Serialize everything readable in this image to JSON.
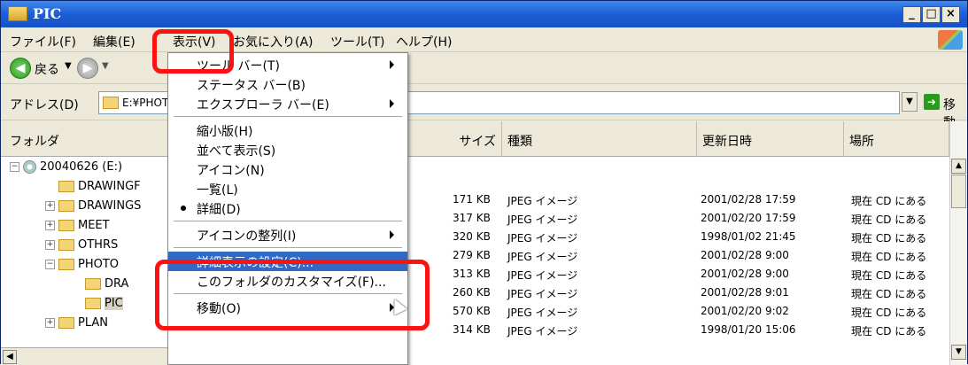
{
  "window": {
    "title": "PIC"
  },
  "menubar": {
    "items": [
      "ファイル(F)",
      "編集(E)",
      "表示(V)",
      "お気に入り(A)",
      "ツール(T)",
      "ヘルプ(H)"
    ]
  },
  "toolbar": {
    "back_label": "戻る"
  },
  "address": {
    "label": "アドレス(D)",
    "value": "E:¥PHOTO¥PIC",
    "go_label": "移動"
  },
  "folder_pane": {
    "header": "フォルダ",
    "tree": [
      {
        "label": "20040626 (E:)",
        "expander": "−",
        "icon": "cd-icon",
        "indent": 0
      },
      {
        "label": "DRAWINGF",
        "expander": "",
        "icon": "folder-icon",
        "indent": 1
      },
      {
        "label": "DRAWINGS",
        "expander": "+",
        "icon": "folder-icon",
        "indent": 1
      },
      {
        "label": "MEET",
        "expander": "+",
        "icon": "folder-icon",
        "indent": 1
      },
      {
        "label": "OTHRS",
        "expander": "+",
        "icon": "folder-icon",
        "indent": 1
      },
      {
        "label": "PHOTO",
        "expander": "−",
        "icon": "folder-icon",
        "indent": 1
      },
      {
        "label": "DRA",
        "expander": "",
        "icon": "folder-icon",
        "indent": 2
      },
      {
        "label": "PIC",
        "expander": "",
        "icon": "folder-icon",
        "indent": 2,
        "selected": true
      },
      {
        "label": "PLAN",
        "expander": "+",
        "icon": "folder-icon",
        "indent": 1
      }
    ]
  },
  "file_pane": {
    "columns": [
      "サイズ",
      "種類",
      "更新日時",
      "場所"
    ],
    "rows": [
      {
        "size": "171 KB",
        "type": "JPEG イメージ",
        "date": "2001/02/28 17:59",
        "location": "現在 CD にある"
      },
      {
        "size": "317 KB",
        "type": "JPEG イメージ",
        "date": "2001/02/20 17:59",
        "location": "現在 CD にある"
      },
      {
        "size": "320 KB",
        "type": "JPEG イメージ",
        "date": "1998/01/02 21:45",
        "location": "現在 CD にある"
      },
      {
        "size": "279 KB",
        "type": "JPEG イメージ",
        "date": "2001/02/28 9:00",
        "location": "現在 CD にある"
      },
      {
        "size": "313 KB",
        "type": "JPEG イメージ",
        "date": "2001/02/28 9:00",
        "location": "現在 CD にある"
      },
      {
        "size": "260 KB",
        "type": "JPEG イメージ",
        "date": "2001/02/28 9:01",
        "location": "現在 CD にある"
      },
      {
        "size": "570 KB",
        "type": "JPEG イメージ",
        "date": "2001/02/20 9:02",
        "location": "現在 CD にある"
      },
      {
        "size": "314 KB",
        "type": "JPEG イメージ",
        "date": "1998/01/20 15:06",
        "location": "現在 CD にある"
      }
    ]
  },
  "view_menu": {
    "items": [
      {
        "label": "ツール バー(T)",
        "submenu": true
      },
      {
        "label": "ステータス バー(B)"
      },
      {
        "label": "エクスプローラ バー(E)",
        "submenu": true
      },
      {
        "separator": true
      },
      {
        "label": "縮小版(H)"
      },
      {
        "label": "並べて表示(S)"
      },
      {
        "label": "アイコン(N)"
      },
      {
        "label": "一覧(L)"
      },
      {
        "label": "詳細(D)",
        "checked": true
      },
      {
        "separator": true
      },
      {
        "label": "アイコンの整列(I)",
        "submenu": true
      },
      {
        "separator": true
      },
      {
        "label": "詳細表示の設定(C)...",
        "highlighted": true
      },
      {
        "label": "このフォルダのカスタマイズ(F)..."
      },
      {
        "separator": true
      },
      {
        "label": "移動(O)",
        "submenu": true
      }
    ]
  },
  "colors": {
    "highlight_box": "#ff1111",
    "menu_highlight": "#316ac5",
    "titlebar": "#1c5dd6"
  }
}
